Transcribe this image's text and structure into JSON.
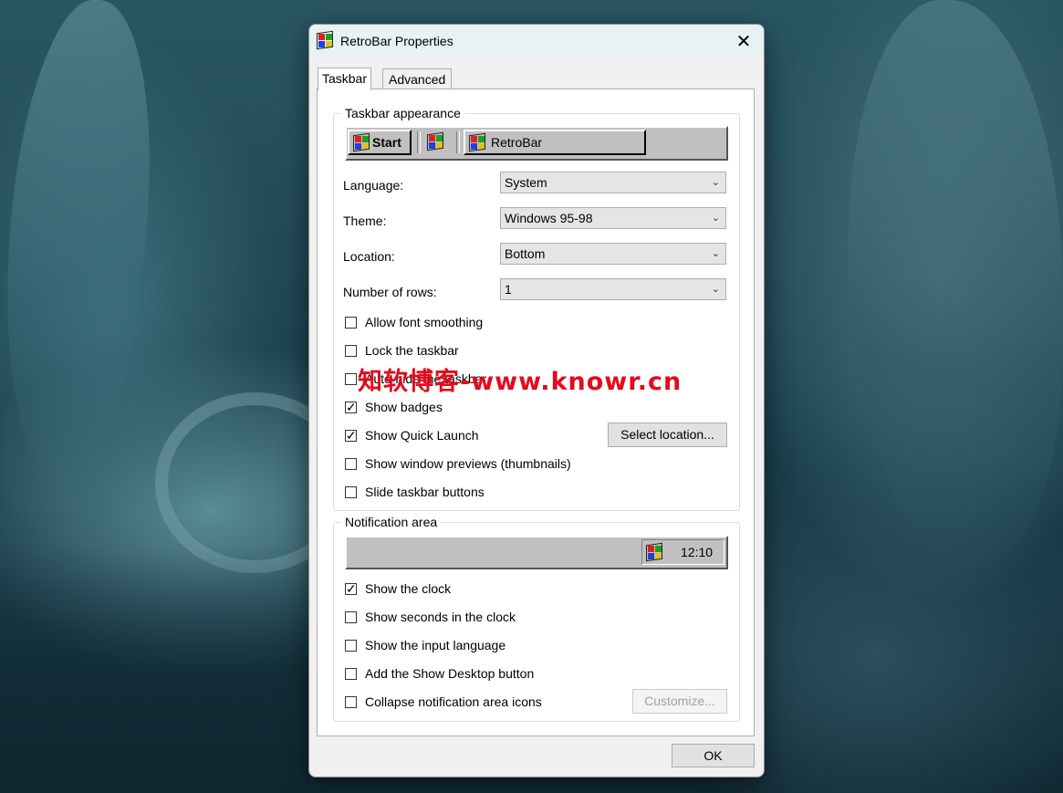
{
  "window": {
    "title": "RetroBar Properties",
    "close_glyph": "✕"
  },
  "tabs": [
    {
      "label": "Taskbar",
      "active": true
    },
    {
      "label": "Advanced",
      "active": false
    }
  ],
  "appearance": {
    "label": "Taskbar appearance",
    "start_label": "Start",
    "task_label": "RetroBar",
    "language_label": "Language:",
    "language_value": "System",
    "theme_label": "Theme:",
    "theme_value": "Windows 95-98",
    "location_label": "Location:",
    "location_value": "Bottom",
    "rows_label": "Number of rows:",
    "rows_value": "1",
    "checks": [
      {
        "label": "Allow font smoothing",
        "checked": false
      },
      {
        "label": "Lock the taskbar",
        "checked": false
      },
      {
        "label": "Auto-hide the taskbar",
        "checked": false
      },
      {
        "label": "Show badges",
        "checked": true
      },
      {
        "label": "Show Quick Launch",
        "checked": true
      },
      {
        "label": "Show window previews (thumbnails)",
        "checked": false
      },
      {
        "label": "Slide taskbar buttons",
        "checked": false
      }
    ],
    "select_location_label": "Select location..."
  },
  "notification": {
    "label": "Notification area",
    "clock_time": "12:10",
    "checks": [
      {
        "label": "Show the clock",
        "checked": true
      },
      {
        "label": "Show seconds in the clock",
        "checked": false
      },
      {
        "label": "Show the input language",
        "checked": false
      },
      {
        "label": "Add the Show Desktop button",
        "checked": false
      },
      {
        "label": "Collapse notification area icons",
        "checked": false
      }
    ],
    "customize_label": "Customize..."
  },
  "footer": {
    "ok_label": "OK"
  },
  "watermark": "知软博客-www.knowr.cn",
  "colors": {
    "checkbox_border": "#333333",
    "watermark": "#e30b1c"
  }
}
